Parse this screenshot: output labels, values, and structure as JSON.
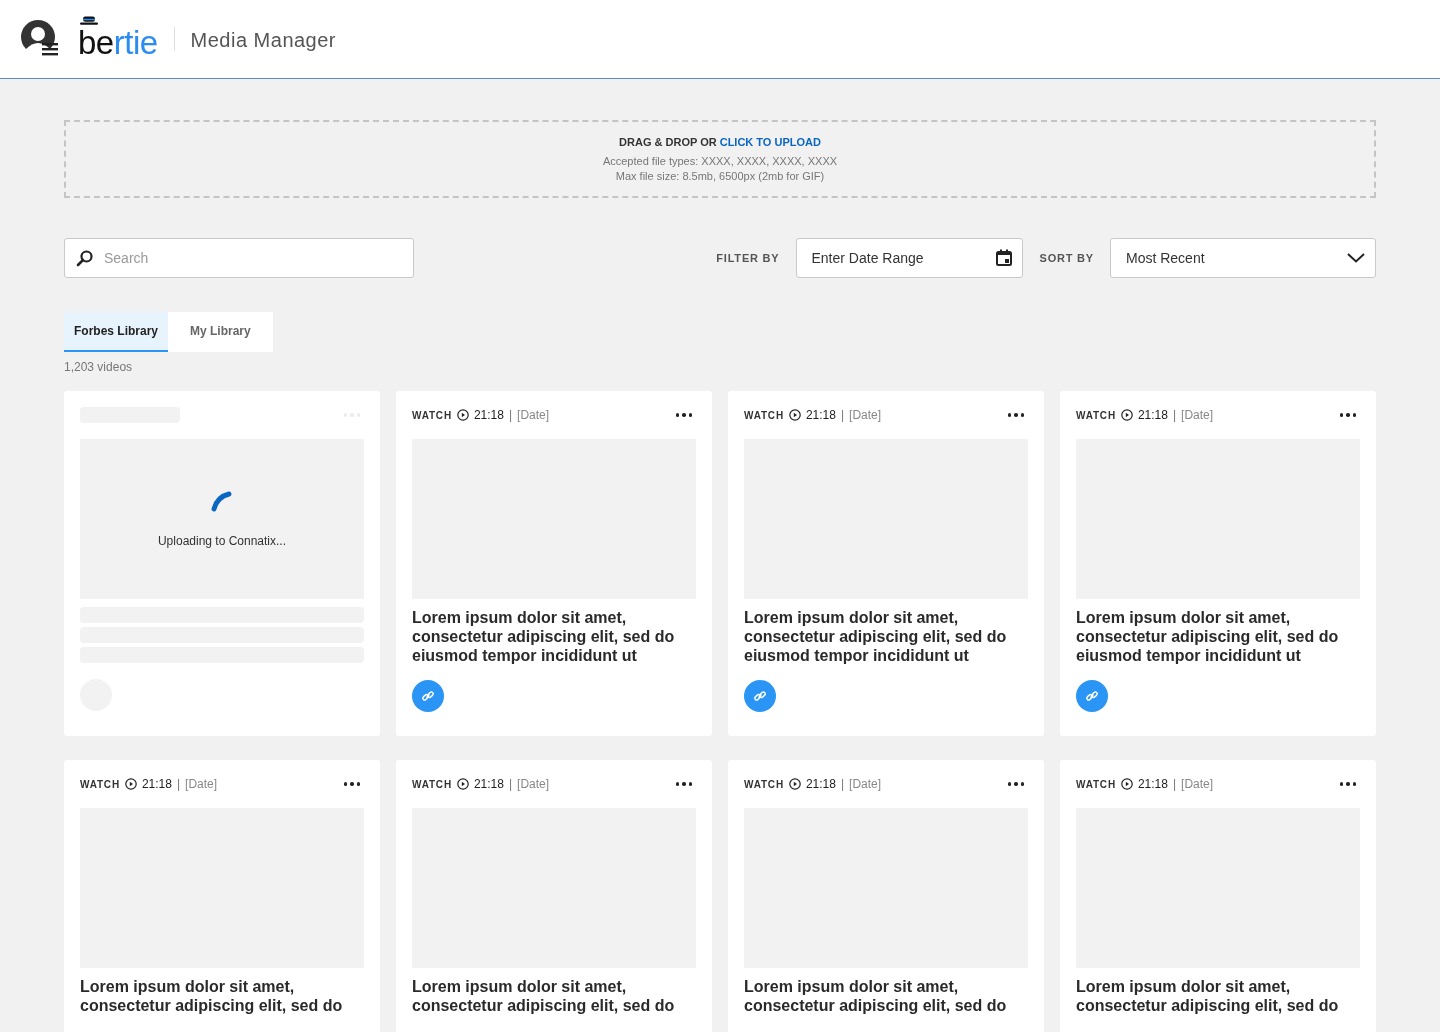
{
  "header": {
    "logo_dark": "be",
    "logo_light": "rtie",
    "title": "Media Manager"
  },
  "upload": {
    "lead": "DRAG & DROP OR",
    "link": "CLICK TO UPLOAD",
    "types": "Accepted file types: XXXX, XXXX, XXXX, XXXX",
    "size": "Max file size: 8.5mb, 6500px  (2mb for GIF)"
  },
  "search": {
    "placeholder": "Search"
  },
  "filter": {
    "label": "FILTER BY",
    "placeholder": "Enter Date Range"
  },
  "sort": {
    "label": "SORT BY",
    "value": "Most Recent"
  },
  "tabs": [
    {
      "label": "Forbes Library",
      "selected": true
    },
    {
      "label": "My Library",
      "selected": false
    }
  ],
  "count": "1,203 videos",
  "cards": [
    {
      "kind": "uploading",
      "status": "Uploading to Connatix..."
    },
    {
      "kind": "video",
      "watch": "WATCH",
      "duration": "21:18",
      "sep": "|",
      "date": "[Date]",
      "title": "Lorem ipsum dolor sit amet, consectetur adipiscing elit, sed do eiusmod tempor incididunt ut",
      "link": true
    },
    {
      "kind": "video",
      "watch": "WATCH",
      "duration": "21:18",
      "sep": "|",
      "date": "[Date]",
      "title": "Lorem ipsum dolor sit amet, consectetur adipiscing elit, sed do eiusmod tempor incididunt ut",
      "link": true
    },
    {
      "kind": "video",
      "watch": "WATCH",
      "duration": "21:18",
      "sep": "|",
      "date": "[Date]",
      "title": "Lorem ipsum dolor sit amet, consectetur adipiscing elit, sed do eiusmod tempor incididunt ut",
      "link": true
    },
    {
      "kind": "video",
      "watch": "WATCH",
      "duration": "21:18",
      "sep": "|",
      "date": "[Date]",
      "title": "Lorem ipsum dolor sit amet, consectetur adipiscing elit, sed do"
    },
    {
      "kind": "video",
      "watch": "WATCH",
      "duration": "21:18",
      "sep": "|",
      "date": "[Date]",
      "title": "Lorem ipsum dolor sit amet, consectetur adipiscing elit, sed do"
    },
    {
      "kind": "video",
      "watch": "WATCH",
      "duration": "21:18",
      "sep": "|",
      "date": "[Date]",
      "title": "Lorem ipsum dolor sit amet, consectetur adipiscing elit, sed do"
    },
    {
      "kind": "video",
      "watch": "WATCH",
      "duration": "21:18",
      "sep": "|",
      "date": "[Date]",
      "title": "Lorem ipsum dolor sit amet, consectetur adipiscing elit, sed do"
    }
  ]
}
